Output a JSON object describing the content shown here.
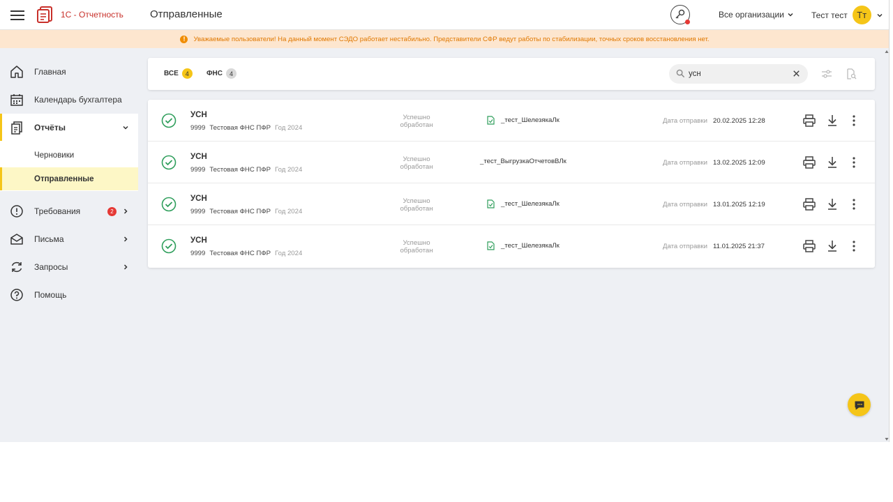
{
  "header": {
    "app_name": "1С - Отчетность",
    "page_title": "Отправленные",
    "org_select": "Все организации",
    "user_name": "Тест тест",
    "avatar_initials": "Тт"
  },
  "banner": {
    "text": "Уважаемые пользователи! На данный момент СЭДО работает нестабильно. Представители СФР ведут работы по стабилизации, точных сроков восстановления нет."
  },
  "sidebar": {
    "items": [
      {
        "label": "Главная",
        "icon": "home-icon"
      },
      {
        "label": "Календарь бухгалтера",
        "icon": "calendar-icon"
      },
      {
        "label": "Отчёты",
        "icon": "reports-icon"
      },
      {
        "label": "Требования",
        "icon": "alert-circle-icon",
        "badge": "2"
      },
      {
        "label": "Письма",
        "icon": "mail-icon"
      },
      {
        "label": "Запросы",
        "icon": "refresh-icon"
      },
      {
        "label": "Помощь",
        "icon": "help-icon"
      }
    ],
    "subitems": [
      {
        "label": "Черновики"
      },
      {
        "label": "Отправленные"
      }
    ]
  },
  "filters": {
    "tabs": [
      {
        "label": "ВСЕ",
        "count": "4"
      },
      {
        "label": "ФНС",
        "count": "4"
      }
    ],
    "search_value": "усн"
  },
  "rows": [
    {
      "title": "УСН",
      "inn": "9999",
      "org": "Тестовая ФНС ПФР",
      "period": "Год 2024",
      "status_line1": "Успешно",
      "status_line2": "обработан",
      "file": "_тест_ШелезякаЛк",
      "date_label": "Дата отправки",
      "date": "20.02.2025 12:28"
    },
    {
      "title": "УСН",
      "inn": "9999",
      "org": "Тестовая ФНС ПФР",
      "period": "Год 2024",
      "status_line1": "Успешно",
      "status_line2": "обработан",
      "file": "_тест_ВыгрузкаОтчетовВЛк",
      "date_label": "Дата отправки",
      "date": "13.02.2025 12:09"
    },
    {
      "title": "УСН",
      "inn": "9999",
      "org": "Тестовая ФНС ПФР",
      "period": "Год 2024",
      "status_line1": "Успешно",
      "status_line2": "обработан",
      "file": "_тест_ШелезякаЛк",
      "date_label": "Дата отправки",
      "date": "13.01.2025 12:19"
    },
    {
      "title": "УСН",
      "inn": "9999",
      "org": "Тестовая ФНС ПФР",
      "period": "Год 2024",
      "status_line1": "Успешно",
      "status_line2": "обработан",
      "file": "_тест_ШелезякаЛк",
      "date_label": "Дата отправки",
      "date": "11.01.2025 21:37"
    }
  ],
  "colors": {
    "accent": "#f5c518",
    "brand": "#c8302a",
    "success": "#2e9e5b",
    "warning_bg": "#fde6cf",
    "warning_text": "#e07800"
  }
}
